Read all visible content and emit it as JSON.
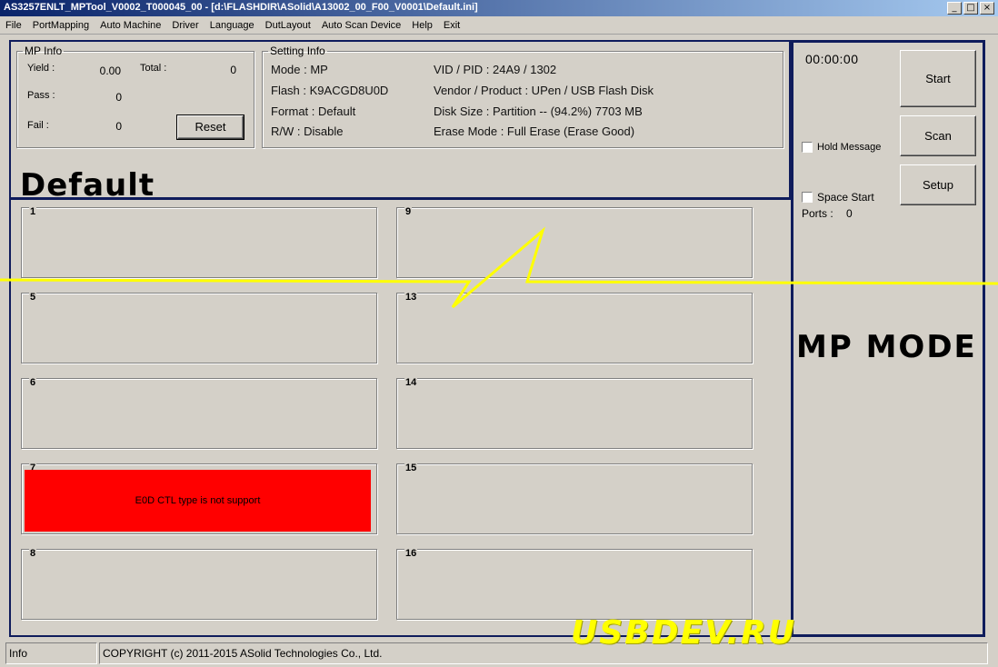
{
  "window": {
    "title": "AS3257ENLT_MPTool_V0002_T000045_00 - [d:\\FLASHDIR\\ASolid\\A13002_00_F00_V0001\\Default.ini]",
    "controls": [
      "_",
      "□",
      "×"
    ]
  },
  "menu": [
    "File",
    "PortMapping",
    "Auto Machine",
    "Driver",
    "Language",
    "DutLayout",
    "Auto Scan Device",
    "Help",
    "Exit"
  ],
  "mp_info": {
    "legend": "MP Info",
    "yield_label": "Yield :",
    "yield_value": "0.00",
    "total_label": "Total :",
    "total_value": "0",
    "pass_label": "Pass :",
    "pass_value": "0",
    "fail_label": "Fail :",
    "fail_value": "0",
    "reset_label": "Reset"
  },
  "setting_info": {
    "legend": "Setting Info",
    "mode": "Mode : MP",
    "flash": "Flash : K9ACGD8U0D",
    "format": "Format : Default",
    "rw": "R/W : Disable",
    "vid_pid": "VID / PID : 24A9 / 1302",
    "vendor_product": "Vendor / Product : UPen / USB Flash Disk",
    "disk_size": "Disk Size : Partition -- (94.2%) 7703 MB",
    "erase_mode": "Erase Mode : Full Erase (Erase Good)"
  },
  "profile_name": "Default",
  "ports": [
    {
      "num": "1",
      "message": ""
    },
    {
      "num": "5",
      "message": ""
    },
    {
      "num": "6",
      "message": ""
    },
    {
      "num": "7",
      "message": "E0D CTL type is not support",
      "status_color": "#ff0000"
    },
    {
      "num": "8",
      "message": ""
    },
    {
      "num": "9",
      "message": ""
    },
    {
      "num": "13",
      "message": ""
    },
    {
      "num": "14",
      "message": ""
    },
    {
      "num": "15",
      "message": ""
    },
    {
      "num": "16",
      "message": ""
    }
  ],
  "right_panel": {
    "timer": "00:00:00",
    "start_label": "Start",
    "scan_label": "Scan",
    "setup_label": "Setup",
    "hold_message": "Hold Message",
    "space_start": "Space Start",
    "ports_label": "Ports :",
    "ports_value": "0",
    "mode_banner": "MP MODE"
  },
  "status": {
    "left": "Info",
    "copyright": "COPYRIGHT (c) 2011-2015  ASolid Technologies Co., Ltd."
  },
  "watermark": "USBDEV.RU",
  "colors": {
    "frame": "#0f1c5c",
    "annotation": "#ffff00",
    "error": "#ff0000"
  }
}
